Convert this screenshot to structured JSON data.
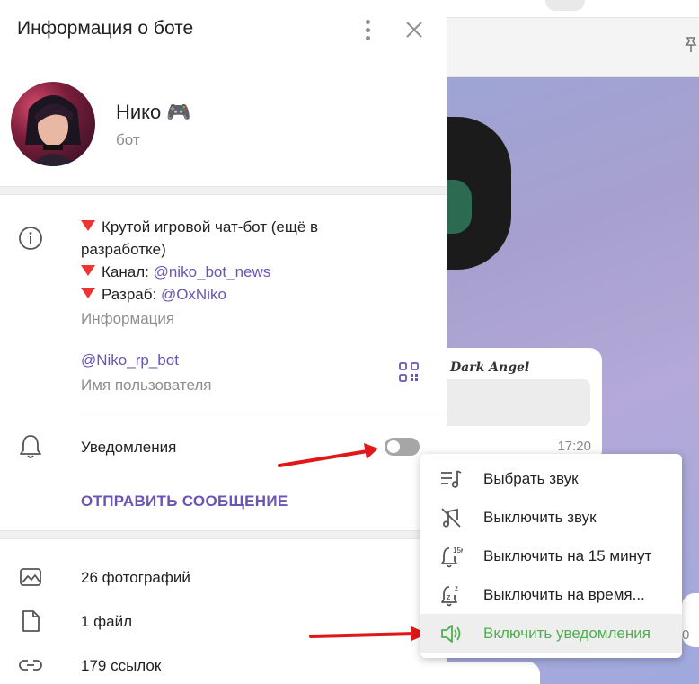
{
  "panel": {
    "title": "Информация о боте",
    "bot_name": "Нико 🎮",
    "bot_subtitle": "бот"
  },
  "description": {
    "lines": [
      {
        "text": "Крутой игровой чат-бот (ещё в разработке)",
        "link": ""
      },
      {
        "text": "Канал: ",
        "link": "@niko_bot_news"
      },
      {
        "text": "Разраб: ",
        "link": "@OxNiko"
      }
    ],
    "caption": "Информация"
  },
  "username": {
    "value": "@Niko_rp_bot",
    "caption": "Имя пользователя"
  },
  "notifications": {
    "label": "Уведомления",
    "enabled": false
  },
  "send_message_label": "ОТПРАВИТЬ СООБЩЕНИЕ",
  "media": [
    {
      "label": "26 фотографий",
      "icon": "photo-icon"
    },
    {
      "label": "1 файл",
      "icon": "file-icon"
    },
    {
      "label": "179 ссылок",
      "icon": "link-icon"
    }
  ],
  "chat": {
    "message_sender": "Dark Angel",
    "message_time": "17:20",
    "side_time_fragment": "0"
  },
  "menu": {
    "items": [
      {
        "label": "Выбрать звук",
        "icon": "sound-select-icon",
        "active": false
      },
      {
        "label": "Выключить звук",
        "icon": "mute-sound-icon",
        "active": false
      },
      {
        "label": "Выключить на 15 минут",
        "icon": "bell-15m-icon",
        "active": false
      },
      {
        "label": "Выключить на время...",
        "icon": "bell-snooze-icon",
        "active": false
      },
      {
        "label": "Включить уведомления",
        "icon": "speaker-on-icon",
        "active": true
      }
    ]
  },
  "colors": {
    "accent": "#6a55b5",
    "active_green": "#4fae4e",
    "arrow_red": "#e01818",
    "description_marker": "#e33333"
  }
}
